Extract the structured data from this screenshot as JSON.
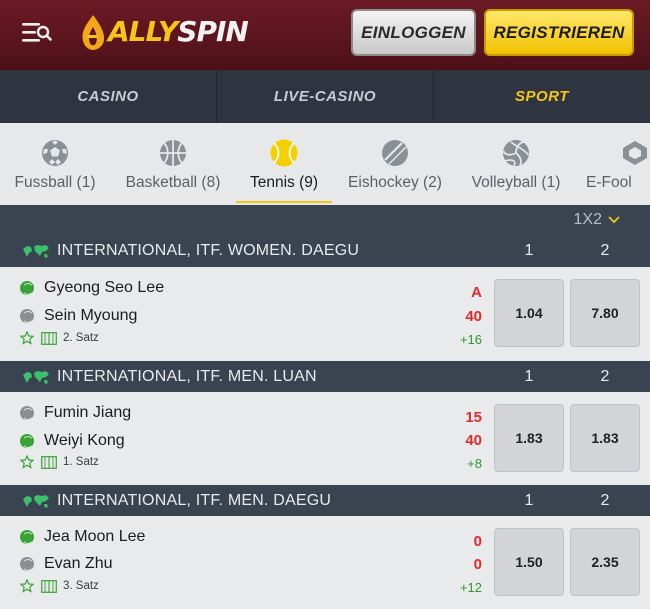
{
  "header": {
    "logo_part1": "ALLY",
    "logo_part2": "SPIN",
    "login_label": "EINLOGGEN",
    "register_label": "REGISTRIEREN"
  },
  "nav": [
    {
      "label": "CASINO",
      "active": false
    },
    {
      "label": "LIVE-CASINO",
      "active": false
    },
    {
      "label": "SPORT",
      "active": true
    }
  ],
  "sports": [
    {
      "label": "Fussball (1)",
      "icon": "soccer-ball-icon"
    },
    {
      "label": "Basketball (8)",
      "icon": "basketball-icon"
    },
    {
      "label": "Tennis (9)",
      "icon": "tennis-ball-icon",
      "active": true
    },
    {
      "label": "Eishockey (2)",
      "icon": "hockey-puck-icon"
    },
    {
      "label": "Volleyball (1)",
      "icon": "volleyball-icon"
    },
    {
      "label": "E-Fool",
      "icon": "esports-icon"
    }
  ],
  "odds_selector": "1X2",
  "leagues": [
    {
      "name": "INTERNATIONAL, ITF. WOMEN. DAEGU",
      "col1": "1",
      "col2": "2",
      "match": {
        "player1": "Gyeong Seo Lee",
        "player1_ball": "green",
        "player2": "Sein Myoung",
        "player2_ball": "gray",
        "score1": "A",
        "score2": "40",
        "set": "2. Satz",
        "more": "+16",
        "odd1": "1.04",
        "odd2": "7.80"
      }
    },
    {
      "name": "INTERNATIONAL, ITF. MEN. LUAN",
      "col1": "1",
      "col2": "2",
      "match": {
        "player1": "Fumin Jiang",
        "player1_ball": "gray",
        "player2": "Weiyi Kong",
        "player2_ball": "green",
        "score1": "15",
        "score2": "40",
        "set": "1. Satz",
        "more": "+8",
        "odd1": "1.83",
        "odd2": "1.83"
      }
    },
    {
      "name": "INTERNATIONAL, ITF. MEN. DAEGU",
      "col1": "1",
      "col2": "2",
      "match": {
        "player1": "Jea Moon Lee",
        "player1_ball": "green",
        "player2": "Evan Zhu",
        "player2_ball": "gray",
        "score1": "0",
        "score2": "0",
        "set": "3. Satz",
        "more": "+12",
        "odd1": "1.50",
        "odd2": "2.35"
      }
    }
  ],
  "colors": {
    "accent": "#f5c518",
    "header_bg": "#5a151e",
    "score_red": "#e02b2b",
    "plus_green": "#2f9a2a"
  }
}
